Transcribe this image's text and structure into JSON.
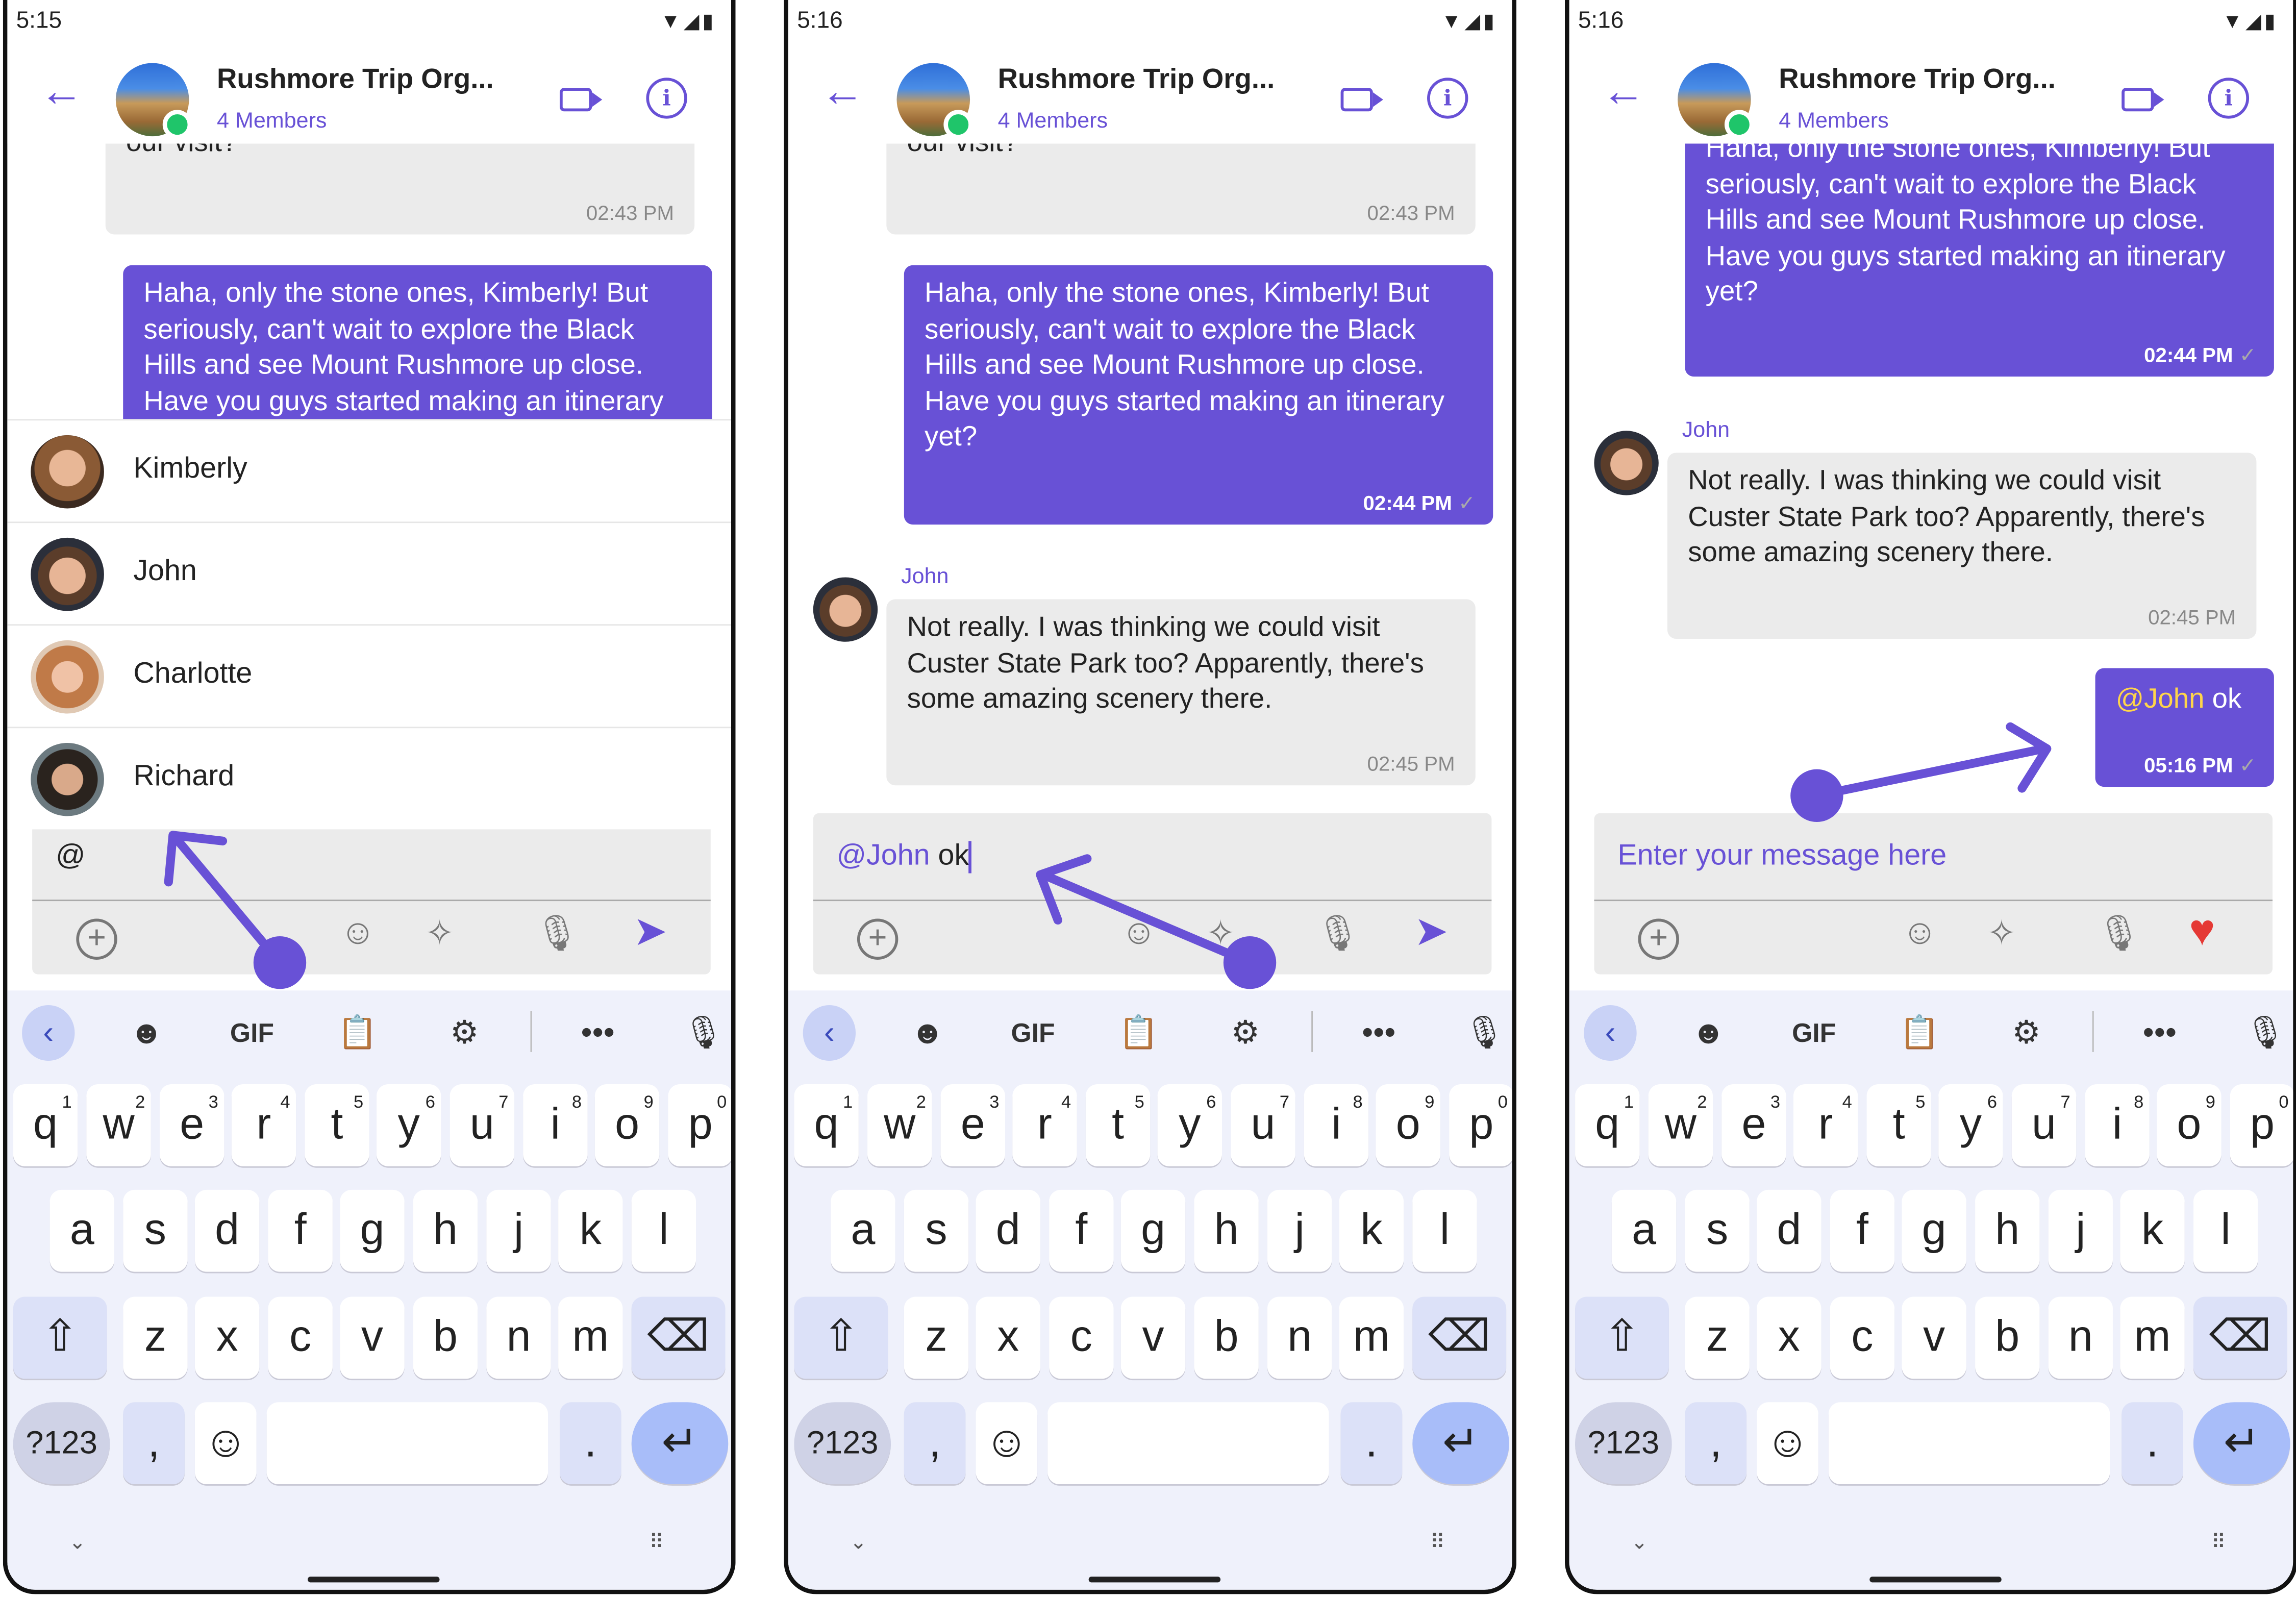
{
  "colors": {
    "accent": "#6851d6",
    "incoming_bubble": "#ebebeb",
    "online": "#1fc56a",
    "heart": "#e53935",
    "keyboard_bg": "#eff1fb"
  },
  "screens": [
    {
      "status": {
        "time": "5:15",
        "icons": "▼◢▮"
      },
      "header": {
        "title": "Rushmore Trip Org...",
        "subtitle": "4 Members",
        "back_icon": "←",
        "info_icon": "i"
      },
      "messages": {
        "m1": {
          "text": "our visit?",
          "time": "02:43 PM"
        },
        "m2": {
          "text": " Haha, only the stone ones, Kimberly! But seriously, can't wait to explore the Black Hills and see Mount Rushmore up close.  Have you guys started making an itinerary yet?"
        }
      },
      "mentions": [
        "Kimberly",
        "John",
        "Charlotte",
        "Richard"
      ],
      "composer": {
        "value": "@"
      }
    },
    {
      "status": {
        "time": "5:16",
        "icons": "▼◢▮"
      },
      "header": {
        "title": "Rushmore Trip Org...",
        "subtitle": "4 Members",
        "back_icon": "←",
        "info_icon": "i"
      },
      "messages": {
        "m1": {
          "text": "our visit?",
          "time": "02:43 PM"
        },
        "m2": {
          "text": " Haha, only the stone ones, Kimberly! But seriously, can't wait to explore the Black Hills and see Mount Rushmore up close.  Have you guys started making an itinerary yet?",
          "time": "02:44 PM",
          "tick": "✓"
        },
        "m3": {
          "sender": "John",
          "text": "Not really.  I was thinking we could visit Custer State Park too? Apparently, there's some amazing scenery there.",
          "time": "02:45 PM"
        }
      },
      "composer": {
        "mention": "@John",
        "value": " ok"
      }
    },
    {
      "status": {
        "time": "5:16",
        "icons": "▼◢▮"
      },
      "header": {
        "title": "Rushmore Trip Org...",
        "subtitle": "4 Members",
        "back_icon": "←",
        "info_icon": "i"
      },
      "messages": {
        "m2": {
          "text": " Haha, only the stone ones, Kimberly! But seriously, can't wait to explore the Black Hills and see Mount Rushmore up close.  Have you guys started making an itinerary yet?",
          "time": "02:44 PM",
          "tick": "✓"
        },
        "m3": {
          "sender": "John",
          "text": "Not really.  I was thinking we could visit Custer State Park too? Apparently, there's some amazing scenery there.",
          "time": "02:45 PM"
        },
        "m4": {
          "mention": "@John",
          "text": " ok",
          "time": "05:16 PM",
          "tick": "✓"
        }
      },
      "composer": {
        "placeholder": "Enter your message here"
      }
    }
  ],
  "composer_tools": {
    "add": "+",
    "sticker": "☺",
    "ai": "✧",
    "mic": "🎙",
    "send": "➤",
    "heart": "♥"
  },
  "keyboard": {
    "toolbar": {
      "back": "‹",
      "sticker": "☻",
      "gif": "GIF",
      "clipboard": "📋",
      "settings": "⚙",
      "more": "•••",
      "mic": "🎙"
    },
    "row1": [
      "q",
      "w",
      "e",
      "r",
      "t",
      "y",
      "u",
      "i",
      "o",
      "p"
    ],
    "row1_hints": [
      "1",
      "2",
      "3",
      "4",
      "5",
      "6",
      "7",
      "8",
      "9",
      "0"
    ],
    "row2": [
      "a",
      "s",
      "d",
      "f",
      "g",
      "h",
      "j",
      "k",
      "l"
    ],
    "row3": [
      "z",
      "x",
      "c",
      "v",
      "b",
      "n",
      "m"
    ],
    "shift": "⇧",
    "backspace": "⌫",
    "symbols": "?123",
    "comma": ",",
    "emoji": "☺",
    "period": ".",
    "enter": "↵",
    "hide": "⌄",
    "grid": "⠿"
  }
}
